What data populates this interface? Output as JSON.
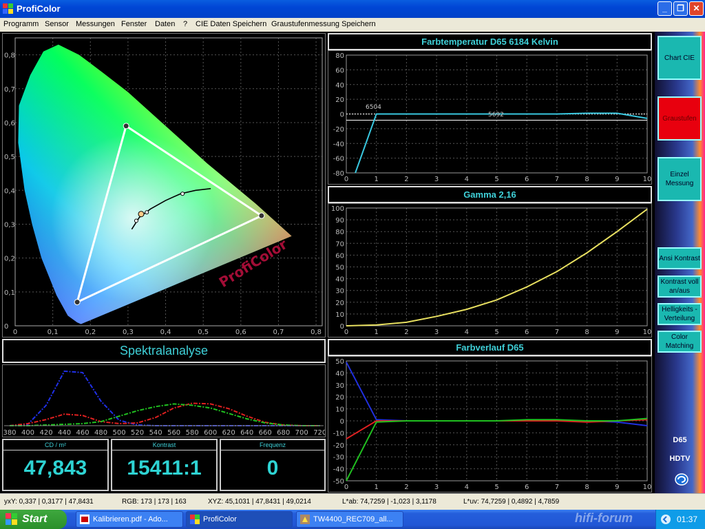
{
  "window": {
    "title": "ProfiColor",
    "min": "_",
    "max": "❐",
    "close": "✕"
  },
  "menu": [
    "Programm",
    "Sensor",
    "Messungen",
    "Fenster",
    "Daten",
    "?",
    "CIE Daten Speichern",
    "Graustufenmessung Speichern"
  ],
  "cie": {
    "watermark": "ProfiColor",
    "x_ticks": [
      "0",
      "0,1",
      "0,2",
      "0,3",
      "0,4",
      "0,5",
      "0,6",
      "0,7",
      "0,8"
    ],
    "y_ticks": [
      "0",
      "0,1",
      "0,2",
      "0,3",
      "0,4",
      "0,5",
      "0,6",
      "0,7",
      "0,8"
    ],
    "triangle": [
      [
        0.295,
        0.59
      ],
      [
        0.655,
        0.325
      ],
      [
        0.165,
        0.07
      ]
    ]
  },
  "temp_panel": {
    "title": "Farbtemperatur D65 6184 Kelvin",
    "ref_label": "6504",
    "mid_label": "5692"
  },
  "gamma_panel": {
    "title": "Gamma 2,16"
  },
  "farbverlauf_panel": {
    "title": "Farbverlauf D65"
  },
  "spectral": {
    "title": "Spektralanalyse",
    "x_ticks": [
      "380",
      "400",
      "420",
      "440",
      "460",
      "480",
      "500",
      "520",
      "540",
      "560",
      "580",
      "600",
      "620",
      "640",
      "660",
      "680",
      "700",
      "720"
    ]
  },
  "readouts": [
    {
      "label": "CD / m²",
      "value": "47,843"
    },
    {
      "label": "Kontrast",
      "value": "15411:1"
    },
    {
      "label": "Frequenz",
      "value": "0"
    }
  ],
  "sidebar": {
    "chart_cie": "Chart CIE",
    "graustufen": "Graustufen",
    "einzel": "Einzel Messung",
    "ansi": "Ansi Kontrast",
    "kontrast_voll": "Kontrast voll an/aus",
    "helligkeit": "Helligkeits - Verteilung",
    "color_matching": "Color Matching",
    "d65": "D65",
    "hdtv": "HDTV"
  },
  "status": {
    "yxy": "yxY: 0,337 | 0,3177 | 47,8431",
    "rgb": "RGB: 173 | 173 | 163",
    "xyz": "XYZ: 45,1031 | 47,8431 | 49,0214",
    "lab": "L*ab: 74,7259 | -1,023 | 3,1178",
    "luv": "L*uv: 74,7259 | 0,4892 | 4,7859"
  },
  "taskbar": {
    "start": "Start",
    "tasks": [
      "Kalibrieren.pdf - Ado...",
      "ProfiColor",
      "TW4400_REC709_all..."
    ],
    "clock": "01:37",
    "watermark": "hifi-forum"
  },
  "chart_data": [
    {
      "type": "line",
      "title": "Farbtemperatur D65 6184 Kelvin",
      "x": [
        0.3,
        1,
        2,
        3,
        4,
        5,
        6,
        7,
        8,
        9,
        10
      ],
      "ylim": [
        -80,
        80
      ],
      "xlim": [
        0,
        10
      ],
      "series": [
        {
          "values": [
            -80,
            0,
            0,
            0,
            0,
            0,
            0,
            0,
            1,
            1,
            -6
          ],
          "color": "#39c8e0"
        }
      ]
    },
    {
      "type": "line",
      "title": "Gamma 2,16",
      "x": [
        0,
        1,
        2,
        3,
        4,
        5,
        6,
        7,
        8,
        9,
        10
      ],
      "ylim": [
        0,
        100
      ],
      "xlim": [
        0,
        10
      ],
      "series": [
        {
          "values": [
            0,
            0.7,
            3,
            8,
            14,
            22,
            33,
            46,
            62,
            80,
            99
          ],
          "color": "#e8e060"
        }
      ]
    },
    {
      "type": "line",
      "title": "Farbverlauf D65",
      "x": [
        0,
        1,
        2,
        3,
        4,
        5,
        6,
        7,
        8,
        9,
        10
      ],
      "ylim": [
        -50,
        50
      ],
      "xlim": [
        0,
        10
      ],
      "series": [
        {
          "values": [
            49,
            1,
            0,
            0,
            0,
            0,
            0,
            0,
            0,
            -1,
            -4
          ],
          "color": "#2030e0"
        },
        {
          "values": [
            -15,
            0,
            0,
            0,
            0,
            0,
            0,
            0,
            -1,
            0,
            1
          ],
          "color": "#e02020"
        },
        {
          "values": [
            -50,
            -1,
            0,
            0,
            0,
            0,
            1,
            1,
            0,
            0,
            2
          ],
          "color": "#20c020"
        }
      ]
    },
    {
      "type": "line",
      "title": "Spektralanalyse",
      "x": [
        380,
        400,
        420,
        440,
        460,
        480,
        500,
        520,
        540,
        560,
        580,
        600,
        620,
        640,
        660,
        680,
        700,
        720
      ],
      "xlim": [
        380,
        730
      ],
      "series": [
        {
          "values": [
            0,
            2,
            30,
            80,
            78,
            36,
            8,
            1,
            0,
            0,
            0,
            0,
            0,
            0,
            0,
            0,
            0,
            0
          ],
          "color": "#2030e8"
        },
        {
          "values": [
            0,
            3,
            9,
            17,
            15,
            6,
            3,
            4,
            12,
            26,
            33,
            32,
            25,
            14,
            5,
            1,
            0,
            0
          ],
          "color": "#e02020"
        },
        {
          "values": [
            0,
            0,
            1,
            2,
            3,
            6,
            14,
            22,
            28,
            32,
            30,
            26,
            18,
            10,
            4,
            1,
            0,
            0
          ],
          "color": "#20c020"
        }
      ]
    }
  ]
}
